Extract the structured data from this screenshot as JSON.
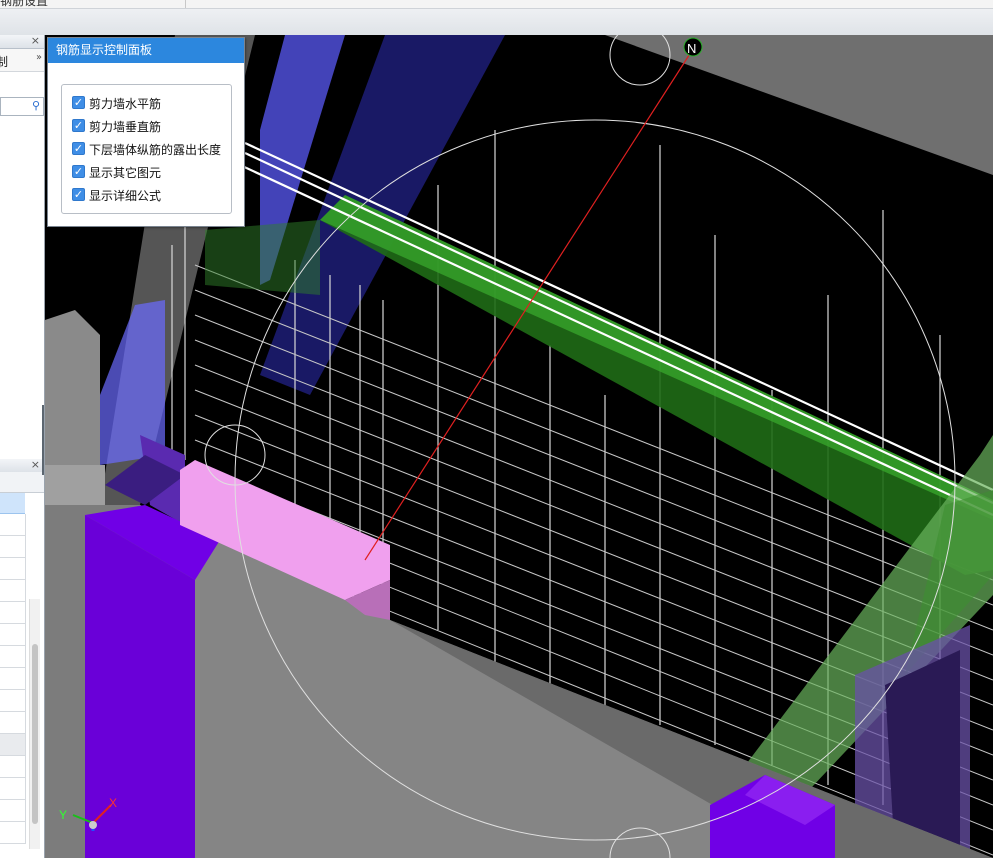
{
  "menu": {
    "cut_text": "钢筋设置"
  },
  "left_dock": {
    "upper_label": "制",
    "more_glyph": "››",
    "close_glyph": "×",
    "search_glyph": "🔍"
  },
  "rebar_panel": {
    "title": "钢筋显示控制面板",
    "options": [
      {
        "label": "剪力墙水平筋",
        "checked": true
      },
      {
        "label": "剪力墙垂直筋",
        "checked": true
      },
      {
        "label": "下层墙体纵筋的露出长度",
        "checked": true
      },
      {
        "label": "显示其它图元",
        "checked": true
      },
      {
        "label": "显示详细公式",
        "checked": true
      }
    ],
    "check_glyph": "✓"
  },
  "viewport": {
    "compass_label": "N",
    "axis_x_label": "X",
    "axis_y_label": "Y",
    "colors": {
      "background": "#000000",
      "wall_gray": "#808080",
      "column_purple": "#7000e6",
      "beam_green": "#2a8a1f",
      "pink_block": "#f0a0ee",
      "blue_column": "#6b6bff",
      "compass_green": "#2ab02a",
      "axis_red": "#e02020"
    }
  }
}
